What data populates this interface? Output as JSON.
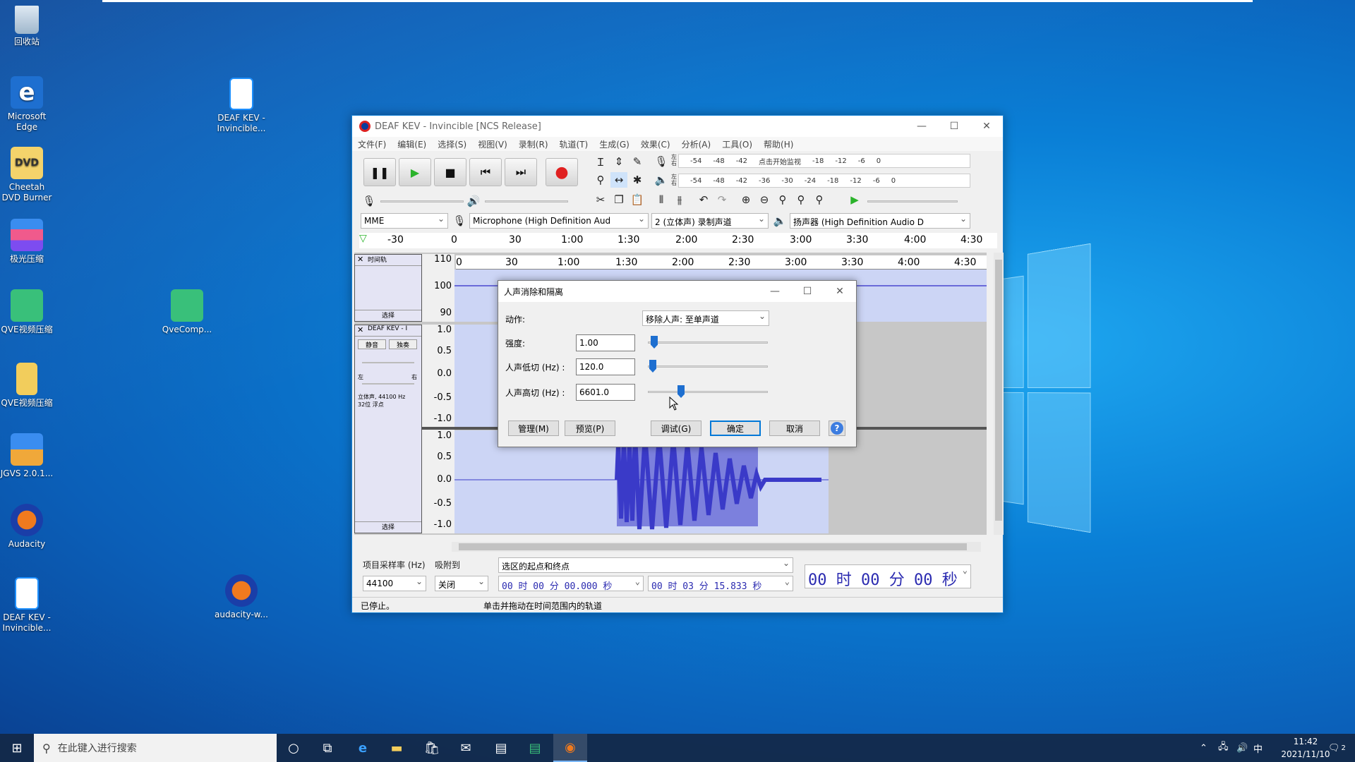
{
  "desktop": {
    "icons": [
      {
        "label": "回收站"
      },
      {
        "label": "Microsoft Edge"
      },
      {
        "label": "Cheetah DVD Burner"
      },
      {
        "label": "极光压缩"
      },
      {
        "label": "QVE视频压缩"
      },
      {
        "label": "QVE视频压缩"
      },
      {
        "label": "JGVS 2.0.1..."
      },
      {
        "label": "Audacity"
      },
      {
        "label": "DEAF KEV - Invincible..."
      },
      {
        "label": "DEAF KEV - Invincible..."
      },
      {
        "label": "QveComp..."
      },
      {
        "label": "audacity-w..."
      }
    ]
  },
  "window": {
    "title": "DEAF KEV - Invincible [NCS Release]",
    "controls": {
      "minimize": "—",
      "maximize": "☐",
      "close": "✕"
    },
    "menu": [
      "文件(F)",
      "编辑(E)",
      "选择(S)",
      "视图(V)",
      "录制(R)",
      "轨道(T)",
      "生成(G)",
      "效果(C)",
      "分析(A)",
      "工具(O)",
      "帮助(H)"
    ],
    "meter_rec": [
      "-54",
      "-48",
      "-42",
      "点击开始监视",
      "-18",
      "-12",
      "-6",
      "0"
    ],
    "meter_play": [
      "-54",
      "-48",
      "-42",
      "-36",
      "-30",
      "-24",
      "-18",
      "-12",
      "-6",
      "0"
    ],
    "meter_lr_labels": [
      "左",
      "右"
    ],
    "device": {
      "host": "MME",
      "mic": "Microphone (High Definition Aud",
      "channels": "2 (立体声) 录制声道",
      "speaker": "扬声器 (High Definition Audio D"
    },
    "timeline": [
      "-30",
      "0",
      "30",
      "1:00",
      "1:30",
      "2:00",
      "2:30",
      "3:00",
      "3:30",
      "4:00",
      "4:30"
    ],
    "track_ruler": [
      "0",
      "30",
      "1:00",
      "1:30",
      "2:00",
      "2:30",
      "3:00",
      "3:30",
      "4:00",
      "4:30"
    ],
    "time_track": {
      "name": "时间轨",
      "scale": [
        "110",
        "100",
        "90"
      ],
      "select": "选择"
    },
    "audio_track": {
      "name": "DEAF KEV - I",
      "mute": "静音",
      "solo": "独奏",
      "pan_left": "左",
      "pan_right": "右",
      "info": "立体声, 44100 Hz\n32位 浮点",
      "scale_top": [
        "1.0",
        "0.5",
        "0.0",
        "-0.5",
        "-1.0"
      ],
      "scale_bottom": [
        "1.0",
        "0.5",
        "0.0",
        "-0.5",
        "-1.0"
      ],
      "select": "选择"
    },
    "bottom": {
      "rate_label": "项目采样率 (Hz)",
      "snap_label": "吸附到",
      "rate_value": "44100",
      "snap_value": "关闭",
      "selection_mode": "选区的起点和终点",
      "start_time": "00 时 00 分 00.000 秒",
      "end_time": "00 时 03 分 15.833 秒",
      "big_time": "00 时 00 分 00 秒",
      "status_left": "已停止。",
      "status_hint": "单击并拖动在时间范围内的轨道"
    }
  },
  "dialog": {
    "title": "人声消除和隔离",
    "action_label": "动作:",
    "action_value": "移除人声: 至单声道",
    "strength_label": "强度:",
    "strength_value": "1.00",
    "strength_level": 0.0,
    "low_label": "人声低切 (Hz) :",
    "low_value": "120.0",
    "high_label": "人声高切 (Hz) :",
    "high_value": "6601.0",
    "buttons": {
      "manage": "管理(M)",
      "preview": "预览(P)",
      "debug": "调试(G)",
      "ok": "确定",
      "cancel": "取消",
      "help": "?"
    }
  },
  "taskbar": {
    "search_placeholder": "在此键入进行搜索",
    "tray": {
      "ime": "中",
      "time": "11:42",
      "date": "2021/11/10",
      "notif_count": "2"
    }
  }
}
